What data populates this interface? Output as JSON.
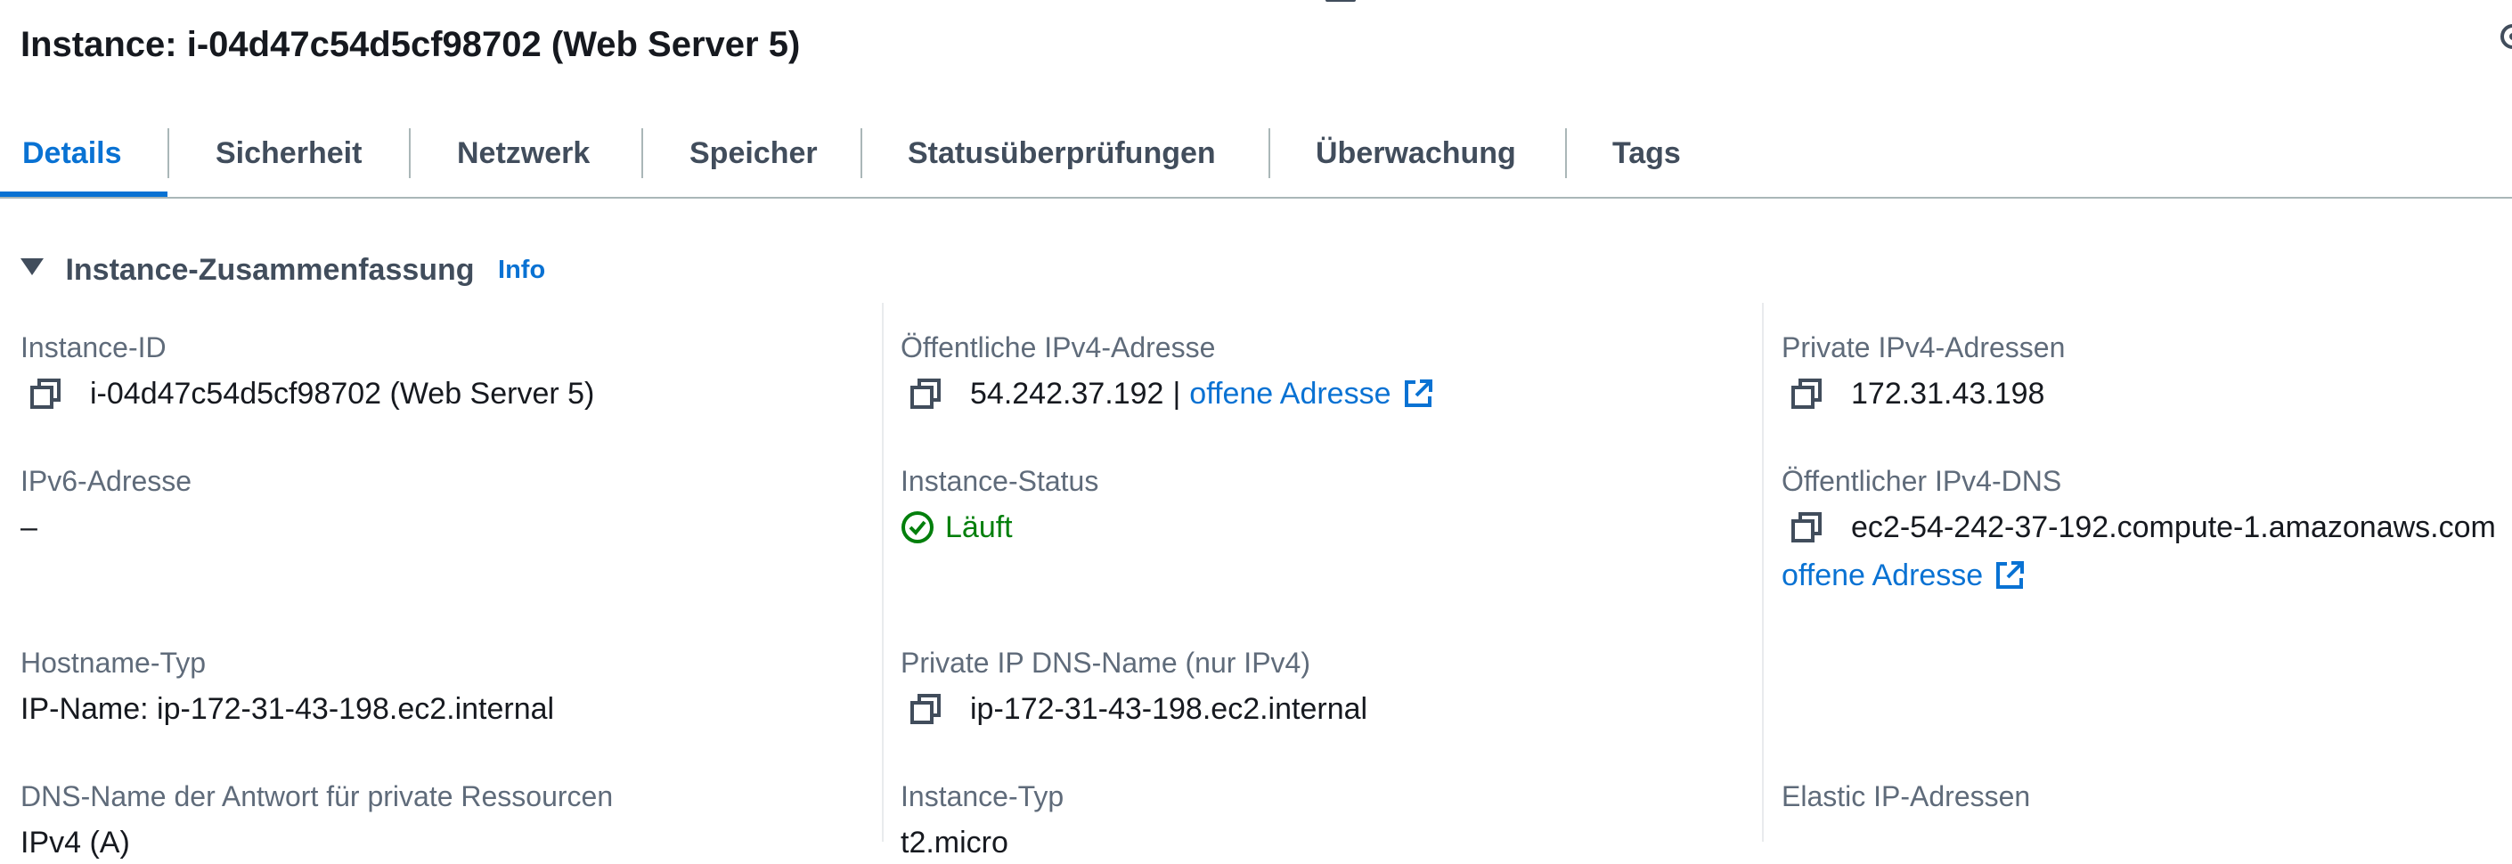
{
  "page": {
    "title": "Instance: i-04d47c54d5cf98702 (Web Server 5)"
  },
  "tabs": [
    {
      "label": "Details",
      "active": true
    },
    {
      "label": "Sicherheit",
      "active": false
    },
    {
      "label": "Netzwerk",
      "active": false
    },
    {
      "label": "Speicher",
      "active": false
    },
    {
      "label": "Statusüberprüfungen",
      "active": false
    },
    {
      "label": "Überwachung",
      "active": false
    },
    {
      "label": "Tags",
      "active": false
    }
  ],
  "section": {
    "title": "Instance-Zusammenfassung",
    "info_link": "Info"
  },
  "fields": {
    "instance_id": {
      "label": "Instance-ID",
      "value": "i-04d47c54d5cf98702 (Web Server 5)"
    },
    "public_ipv4": {
      "label": "Öffentliche IPv4-Adresse",
      "value": "54.242.37.192",
      "separator": "|",
      "link": "offene Adresse"
    },
    "private_ipv4": {
      "label": "Private IPv4-Adressen",
      "value": "172.31.43.198"
    },
    "ipv6": {
      "label": "IPv6-Adresse",
      "value": "–"
    },
    "instance_status": {
      "label": "Instance-Status",
      "value": "Läuft"
    },
    "public_dns": {
      "label": "Öffentlicher IPv4-DNS",
      "value": "ec2-54-242-37-192.compute-1.amazonaws.com",
      "link": "offene Adresse"
    },
    "hostname_type": {
      "label": "Hostname-Typ",
      "value": "IP-Name: ip-172-31-43-198.ec2.internal"
    },
    "private_dns": {
      "label": "Private IP DNS-Name (nur IPv4)",
      "value": "ip-172-31-43-198.ec2.internal"
    },
    "dns_answer": {
      "label": "DNS-Name der Antwort für private Ressourcen",
      "value": "IPv4 (A)"
    },
    "instance_type": {
      "label": "Instance-Typ",
      "value": "t2.micro"
    },
    "elastic_ip": {
      "label": "Elastic IP-Adressen",
      "value": ""
    }
  },
  "colors": {
    "accent": "#0972d3",
    "success": "#037f0c",
    "text": "#16191f",
    "label": "#5f6b7a"
  },
  "icons": [
    "menu-icon",
    "settings-icon",
    "caret-down-icon",
    "copy-icon",
    "external-link-icon",
    "status-ok-icon"
  ]
}
